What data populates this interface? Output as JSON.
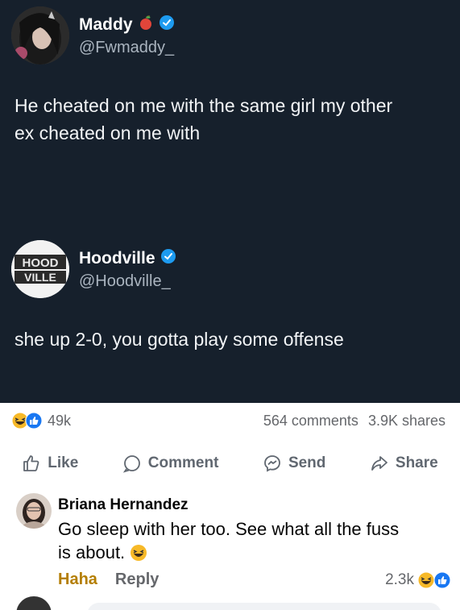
{
  "tweet1": {
    "name": "Maddy",
    "handle": "@Fwmaddy_",
    "text_line1": "He cheated on me with the same girl my other",
    "text_line2": "ex cheated on me with"
  },
  "tweet2": {
    "name": "Hoodville",
    "handle": "@Hoodville_",
    "logo_text_top": "HOOD",
    "logo_text_bottom": "VILLE",
    "text": "she up 2-0, you gotta play some offense"
  },
  "post": {
    "reaction_count": "49k",
    "comments": "564 comments",
    "shares": "3.9K shares",
    "actions": {
      "like": "Like",
      "comment": "Comment",
      "send": "Send",
      "share": "Share"
    }
  },
  "comment": {
    "author": "Briana Hernandez",
    "text_line1": "Go sleep with her too. See what all the fuss",
    "text_line2": "is about.",
    "reaction_link": "Haha",
    "reply_link": "Reply",
    "reaction_count": "2.3k"
  },
  "colors": {
    "twitter_bg": "#16202c",
    "verified_blue": "#1d9bf0",
    "fb_like_blue": "#1877f2",
    "haha_yellow": "#f7b928"
  }
}
